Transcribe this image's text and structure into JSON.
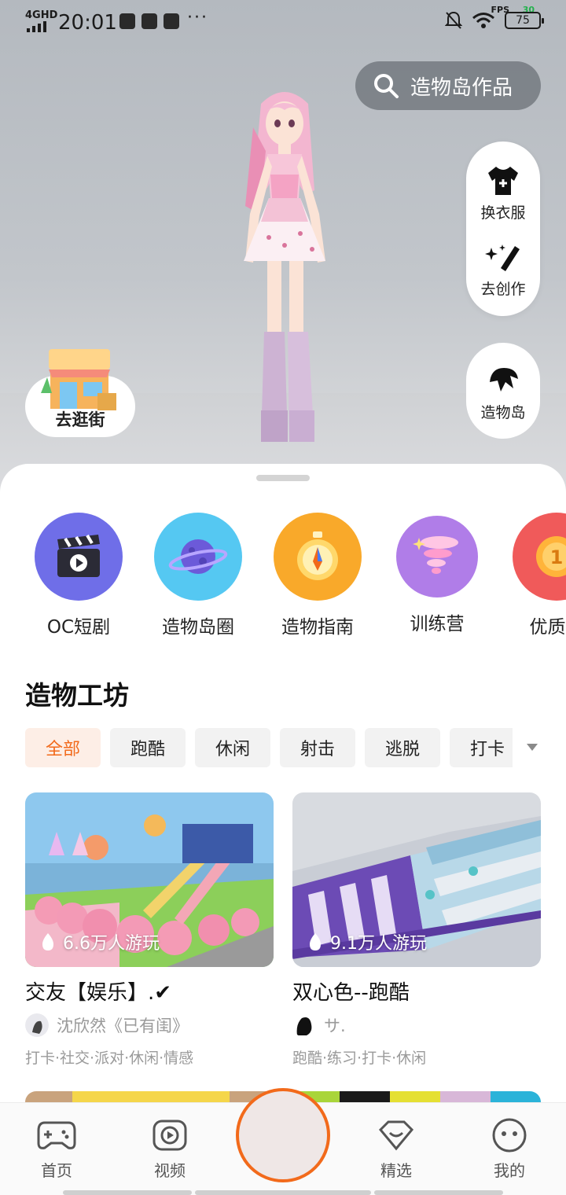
{
  "status_bar": {
    "network": "4GHD",
    "time": "20:01",
    "more": "···",
    "fps_label": "FPS",
    "fps_value": "30",
    "battery": "75"
  },
  "search": {
    "label": "造物岛作品",
    "icon": "search-icon"
  },
  "side_menu": {
    "change_clothes": "换衣服",
    "create": "去创作",
    "island": "造物岛"
  },
  "shop": {
    "label": "去逛街"
  },
  "quick_actions": [
    {
      "label": "OC短剧",
      "icon": "clapperboard-icon",
      "color": "#6f6ee8"
    },
    {
      "label": "造物岛圈",
      "icon": "planet-icon",
      "color": "#55c8f2"
    },
    {
      "label": "造物指南",
      "icon": "compass-icon",
      "color": "#f9a92a"
    },
    {
      "label": "训练营",
      "icon": "tornado-icon",
      "color": "#b07de8"
    },
    {
      "label": "优质作",
      "icon": "medal-icon",
      "color": "#f05a5a"
    }
  ],
  "workshop": {
    "title": "造物工坊",
    "chips": [
      "全部",
      "跑酷",
      "休闲",
      "射击",
      "逃脱",
      "打卡"
    ],
    "active_chip": "全部"
  },
  "cards": [
    {
      "plays": "6.6万人游玩",
      "title": "交友【娱乐】.✔",
      "author": "沈欣然《已有闺》",
      "tags": "打卡·社交·派对·休闲·情感"
    },
    {
      "plays": "9.1万人游玩",
      "title": "双心色--跑酷",
      "author": "サ.",
      "tags": "跑酷·练习·打卡·休闲"
    }
  ],
  "bottom_nav": {
    "home": "首页",
    "video": "视频",
    "featured": "精选",
    "mine": "我的"
  },
  "accent_color": "#f26a1b"
}
